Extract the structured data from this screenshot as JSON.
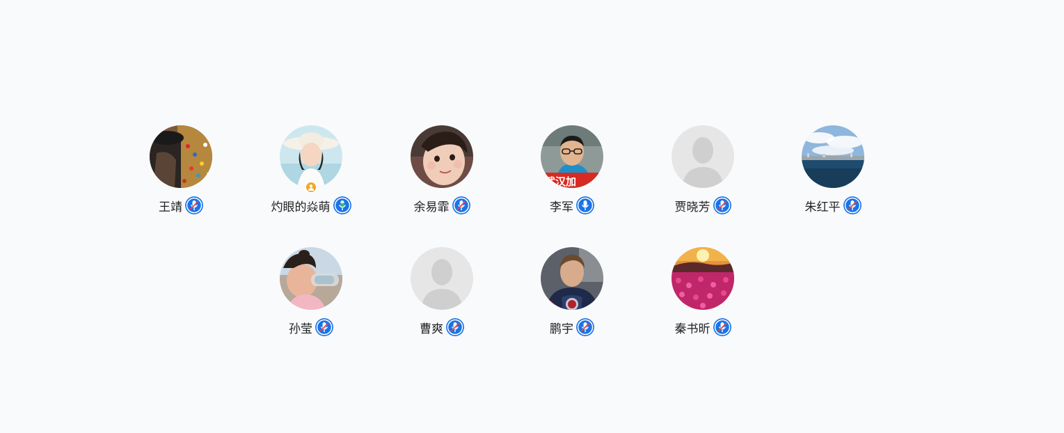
{
  "participants": [
    {
      "name": "王靖",
      "avatar": "photo-stadium",
      "mic": "muted",
      "host": false
    },
    {
      "name": "灼眼的焱萌",
      "avatar": "photo-girl-hat",
      "mic": "active",
      "host": true
    },
    {
      "name": "余易霏",
      "avatar": "photo-child",
      "mic": "muted",
      "host": false
    },
    {
      "name": "李军",
      "avatar": "photo-man-glasses",
      "mic": "on",
      "host": false
    },
    {
      "name": "贾晓芳",
      "avatar": "default-silhouette",
      "mic": "muted",
      "host": false
    },
    {
      "name": "朱红平",
      "avatar": "photo-harbor",
      "mic": "muted",
      "host": false
    },
    {
      "name": "孙莹",
      "avatar": "photo-girl-drinking",
      "mic": "muted",
      "host": false
    },
    {
      "name": "曹爽",
      "avatar": "default-silhouette",
      "mic": "muted",
      "host": false
    },
    {
      "name": "鹏宇",
      "avatar": "photo-superhero",
      "mic": "muted",
      "host": false
    },
    {
      "name": "秦书昕",
      "avatar": "photo-flower-sunset",
      "mic": "muted",
      "host": false
    }
  ],
  "colors": {
    "background": "#f9fafb",
    "mic_blue": "#1a73e8",
    "mic_active_green": "#34c759",
    "host_badge": "#f5a623"
  }
}
